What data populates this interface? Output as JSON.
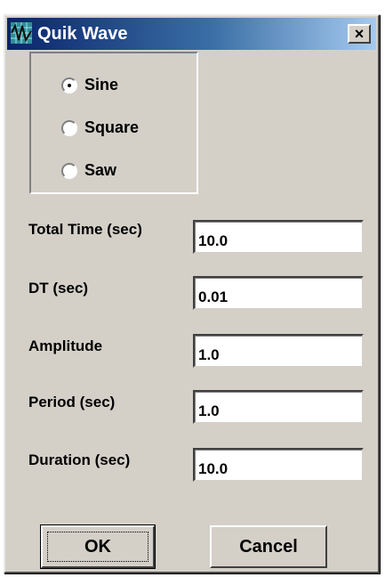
{
  "window": {
    "title": "Quik Wave",
    "close_label": "×",
    "icon": "wave-app-icon"
  },
  "wave_type": {
    "options": [
      {
        "label": "Sine",
        "selected": true
      },
      {
        "label": "Square",
        "selected": false
      },
      {
        "label": "Saw",
        "selected": false
      }
    ]
  },
  "fields": [
    {
      "label": "Total Time (sec)",
      "value": "10.0"
    },
    {
      "label": "DT (sec)",
      "value": "0.01"
    },
    {
      "label": "Amplitude",
      "value": "1.0"
    },
    {
      "label": "Period (sec)",
      "value": "1.0"
    },
    {
      "label": "Duration (sec)",
      "value": "10.0"
    }
  ],
  "buttons": {
    "ok": "OK",
    "cancel": "Cancel"
  }
}
